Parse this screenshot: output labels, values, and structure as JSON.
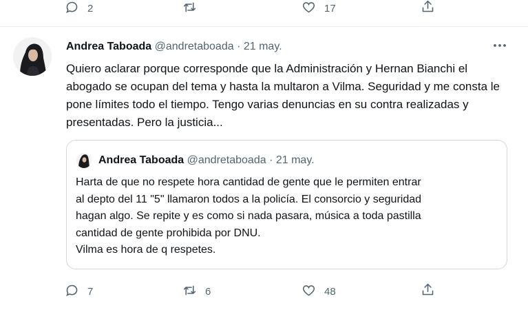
{
  "previous_tweet": {
    "reply_count": "2",
    "retweet_count": "",
    "like_count": "17"
  },
  "tweet": {
    "author_name": "Andrea Taboada",
    "handle": "@andretaboada",
    "separator": "·",
    "date": "21 may.",
    "text": "Quiero aclarar porque corresponde que la Administración y Hernan Bianchi el abogado se ocupan del tema y hasta la multaron a Vilma. Seguridad y me consta le pone límites todo el tiempo. Tengo varias denuncias en su contra realizadas y presentadas. Pero la justicia...",
    "reply_count": "7",
    "retweet_count": "6",
    "like_count": "48"
  },
  "quoted_tweet": {
    "author_name": "Andrea Taboada",
    "handle": "@andretaboada",
    "separator": "·",
    "date": "21 may.",
    "text_lines": [
      "Harta de que no respete hora cantidad de gente que le permiten entrar",
      "al depto del 11 \"5\" llamaron todos a la policía. El consorcio y seguridad",
      "hagan algo. Se repite y es como si nada pasara, música a toda pastilla",
      "cantidad de gente prohibida por DNU.",
      "Vilma es hora de q respetes."
    ]
  },
  "icons": {
    "reply": "reply-icon",
    "retweet": "retweet-icon",
    "like": "like-icon",
    "share": "share-icon",
    "more": "more-icon"
  },
  "colors": {
    "text": "#0f1419",
    "muted": "#536471",
    "border": "#cfd9de"
  }
}
